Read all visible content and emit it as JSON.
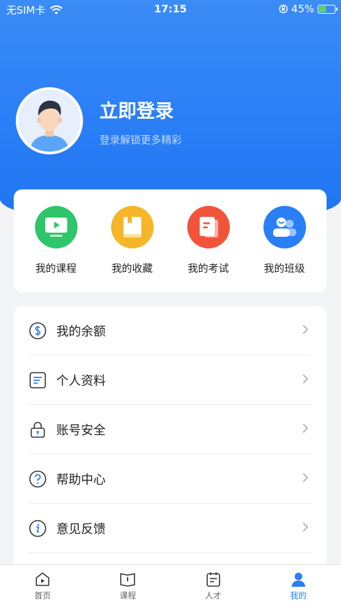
{
  "status_bar": {
    "carrier": "无SIM卡",
    "time": "17:15",
    "battery_percent": "45%",
    "battery_level": 0.45
  },
  "profile": {
    "login_title": "立即登录",
    "login_subtitle": "登录解锁更多精彩"
  },
  "shortcuts": [
    {
      "label": "我的课程",
      "icon": "play-screen-icon",
      "color": "#2fc56b"
    },
    {
      "label": "我的收藏",
      "icon": "bookmark-icon",
      "color": "#f6b629"
    },
    {
      "label": "我的考试",
      "icon": "exam-doc-icon",
      "color": "#f2543a"
    },
    {
      "label": "我的班级",
      "icon": "class-people-icon",
      "color": "#2a7ef6"
    }
  ],
  "menu": [
    {
      "label": "我的余额",
      "icon": "balance-icon"
    },
    {
      "label": "个人资料",
      "icon": "profile-doc-icon"
    },
    {
      "label": "账号安全",
      "icon": "lock-icon"
    },
    {
      "label": "帮助中心",
      "icon": "help-icon"
    },
    {
      "label": "意见反馈",
      "icon": "info-icon"
    }
  ],
  "tabs": [
    {
      "label": "首页",
      "icon": "home-icon"
    },
    {
      "label": "课程",
      "icon": "book-icon"
    },
    {
      "label": "人才",
      "icon": "calendar-icon"
    },
    {
      "label": "我的",
      "icon": "user-icon",
      "active": true
    }
  ],
  "colors": {
    "primary": "#2a7ef6",
    "background": "#f3f4f6"
  }
}
